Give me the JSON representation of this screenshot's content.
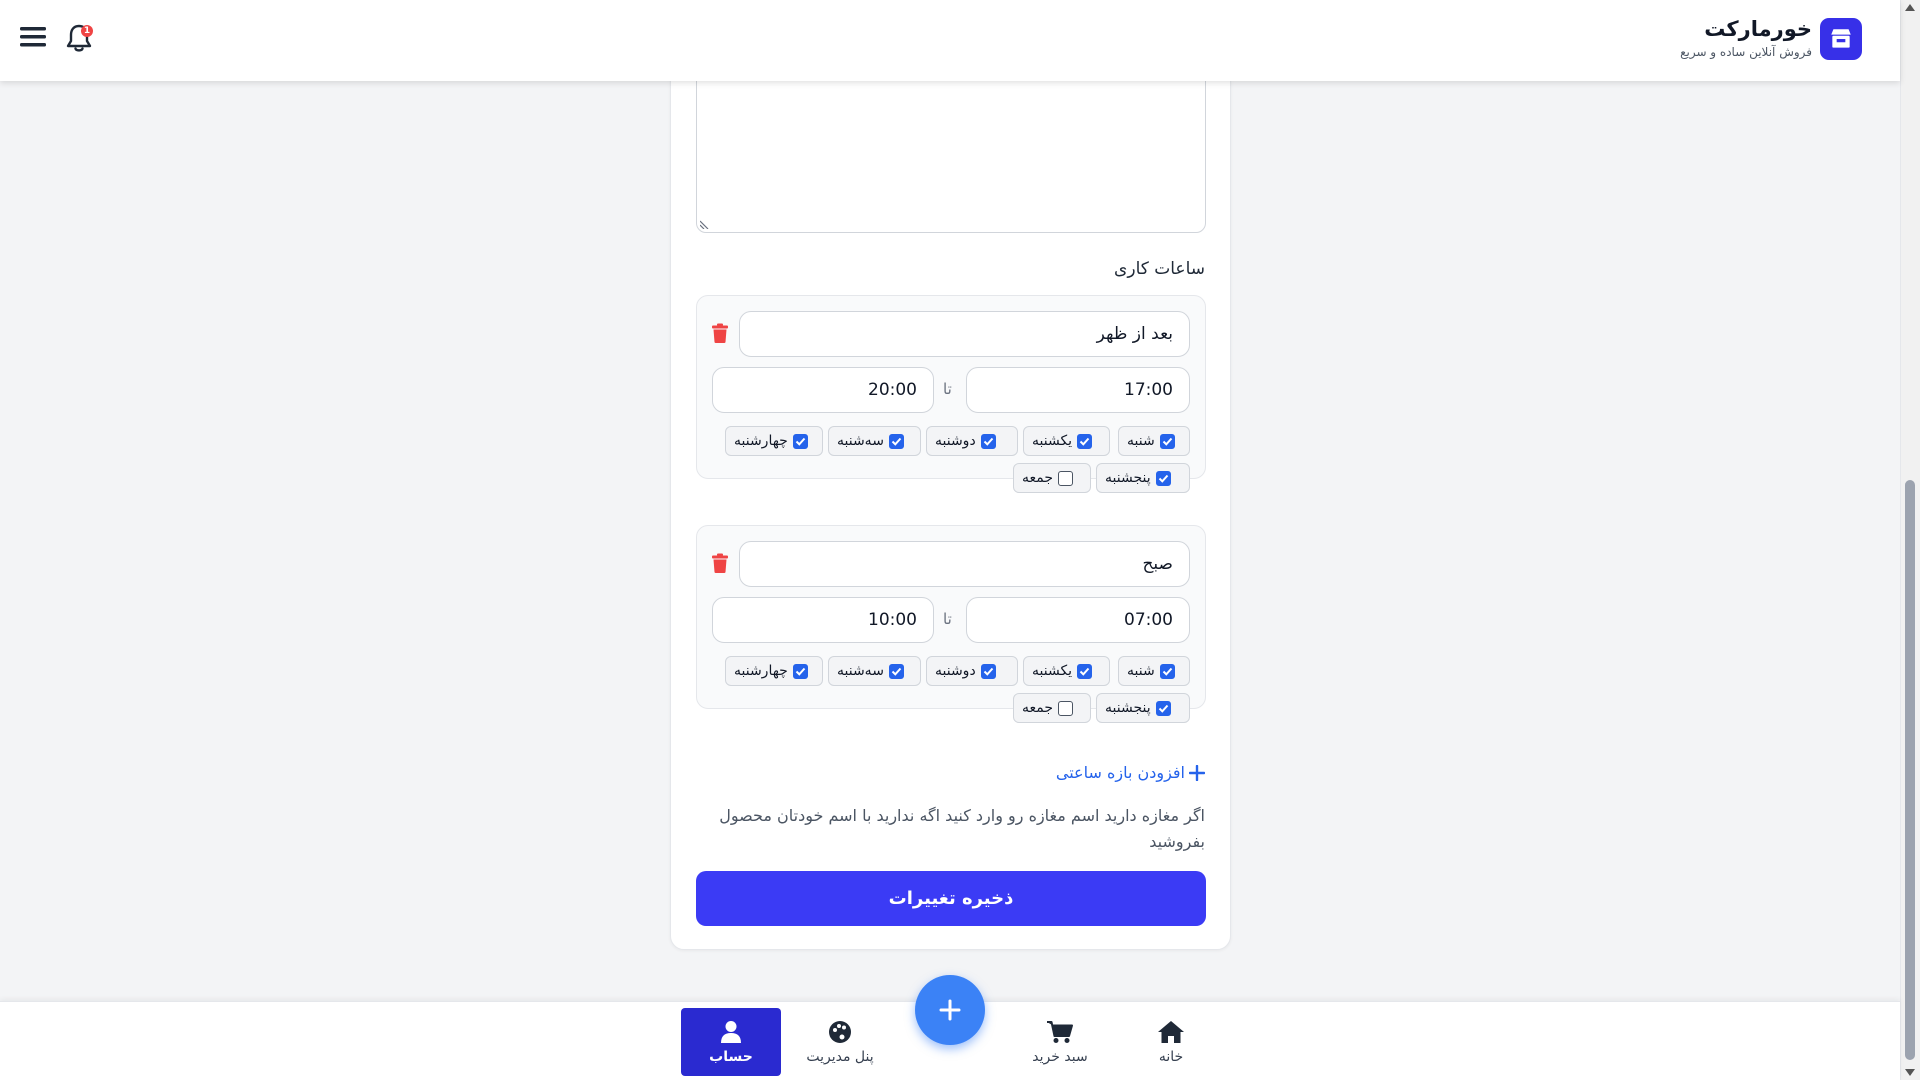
{
  "header": {
    "brand_name": "خورمارکت",
    "brand_tagline": "فروش آنلاین ساده و سریع",
    "notification_count": "1"
  },
  "form": {
    "section_title": "ساعات کاری",
    "to_label": "تا",
    "slots": [
      {
        "name": "بعد از ظهر",
        "from": "17:00",
        "to": "20:00",
        "days": [
          {
            "label": "شنبه",
            "checked": true
          },
          {
            "label": "یکشنبه",
            "checked": true
          },
          {
            "label": "دوشنبه",
            "checked": true
          },
          {
            "label": "سه‌شنبه",
            "checked": true
          },
          {
            "label": "چهارشنبه",
            "checked": true
          },
          {
            "label": "پنجشنبه",
            "checked": true
          },
          {
            "label": "جمعه",
            "checked": false
          }
        ]
      },
      {
        "name": "صبح",
        "from": "07:00",
        "to": "10:00",
        "days": [
          {
            "label": "شنبه",
            "checked": true
          },
          {
            "label": "یکشنبه",
            "checked": true
          },
          {
            "label": "دوشنبه",
            "checked": true
          },
          {
            "label": "سه‌شنبه",
            "checked": true
          },
          {
            "label": "چهارشنبه",
            "checked": true
          },
          {
            "label": "پنجشنبه",
            "checked": true
          },
          {
            "label": "جمعه",
            "checked": false
          }
        ]
      }
    ],
    "add_range_label": "افزودن بازه ساعتی",
    "help_text": "اگر مغازه دارید اسم مغازه رو وارد کنید اگه ندارید با اسم خودتان محصول بفروشید",
    "save_label": "ذخیره تغییرات"
  },
  "bottom_nav": {
    "home": "خانه",
    "cart": "سبد خرید",
    "admin_panel": "پنل مدیریت",
    "account": "حساب"
  },
  "colors": {
    "primary": "#3b3bf5",
    "brand": "#3730e8",
    "fab": "#3b82f6",
    "link": "#2563eb",
    "danger": "#ef4444"
  }
}
